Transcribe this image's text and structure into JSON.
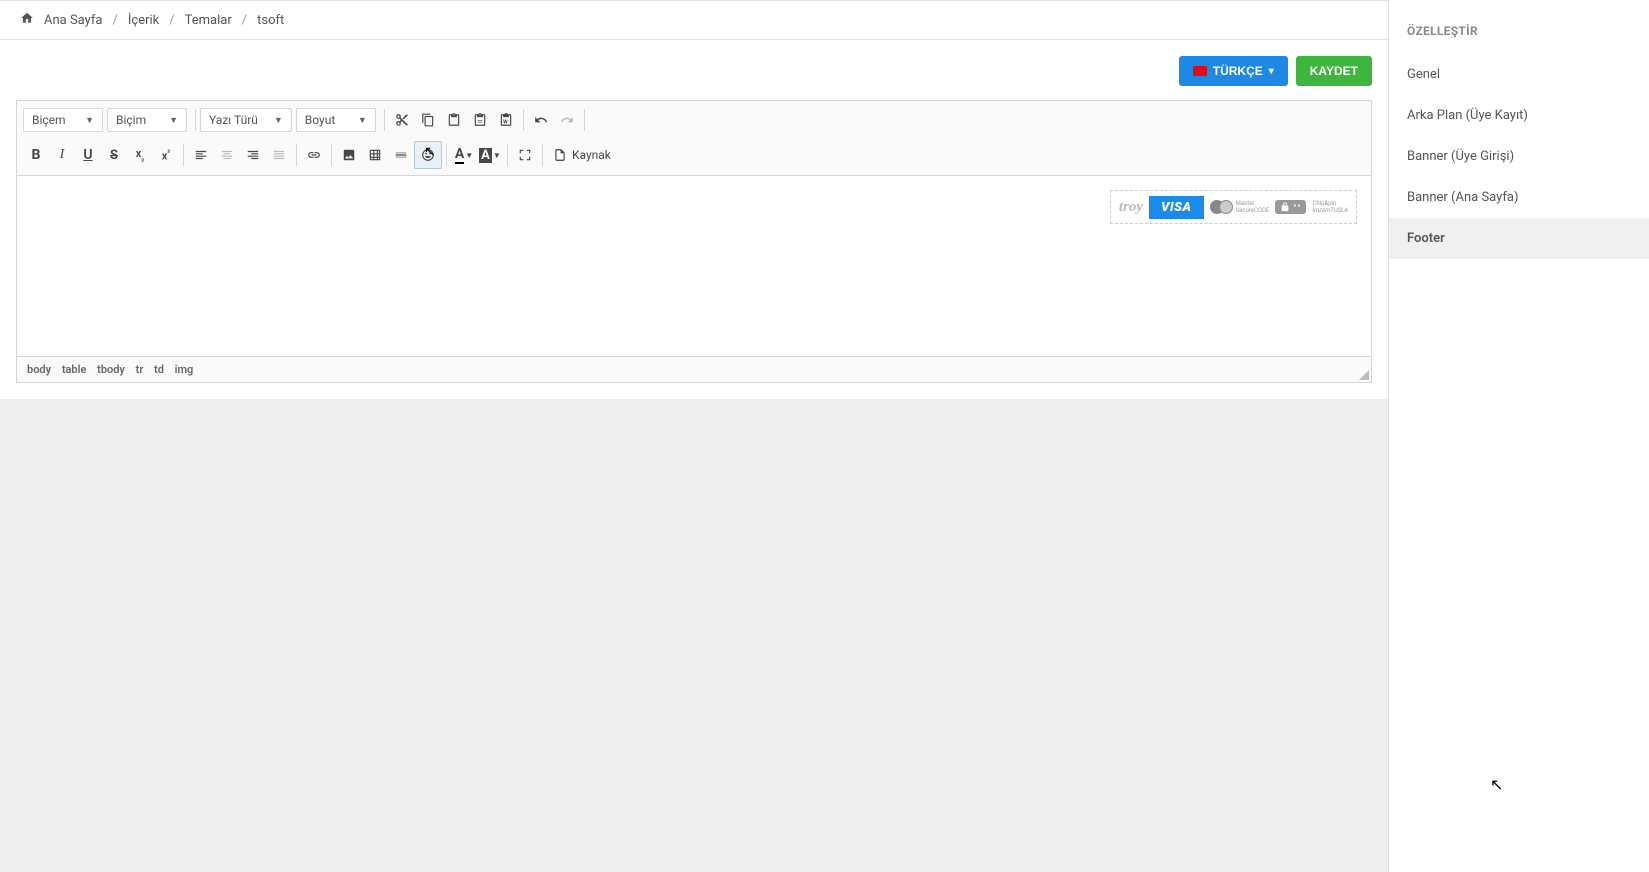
{
  "breadcrumb": [
    "Ana Sayfa",
    "İçerik",
    "Temalar",
    "tsoft"
  ],
  "buttons": {
    "language": "TÜRKÇE",
    "save": "KAYDET"
  },
  "toolbar": {
    "combos": {
      "style": "Biçem",
      "format": "Biçim",
      "font": "Yazı Türü",
      "size": "Boyut"
    },
    "source_label": "Kaynak"
  },
  "payment": {
    "troy": "troy",
    "visa": "VISA",
    "mc_line1": "Master",
    "mc_line2": "SecureCODE",
    "chip_line1": "Chip&pin",
    "chip_line2": "İmzamTUŞLA"
  },
  "path": [
    "body",
    "table",
    "tbody",
    "tr",
    "td",
    "img"
  ],
  "sidebar": {
    "title": "ÖZELLEŞTİR",
    "items": [
      "Genel",
      "Arka Plan (Üye Kayıt)",
      "Banner (Üye Girişi)",
      "Banner (Ana Sayfa)",
      "Footer"
    ],
    "active_index": 4
  }
}
